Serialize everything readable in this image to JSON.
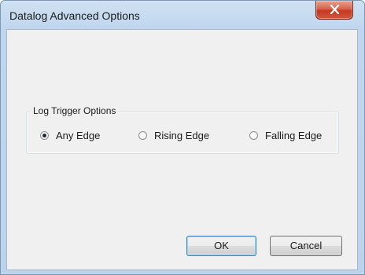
{
  "window": {
    "title": "Datalog Advanced Options",
    "close_glyph": "close-icon"
  },
  "group": {
    "legend": "Log Trigger Options",
    "options": [
      {
        "label": "Any Edge",
        "checked": true
      },
      {
        "label": "Rising Edge",
        "checked": false
      },
      {
        "label": "Falling Edge",
        "checked": false
      }
    ]
  },
  "buttons": {
    "ok_label": "OK",
    "cancel_label": "Cancel"
  },
  "colors": {
    "title_bar": "#c0d6ee",
    "client_bg": "#f0f0f0",
    "close_button": "#c3391f"
  }
}
